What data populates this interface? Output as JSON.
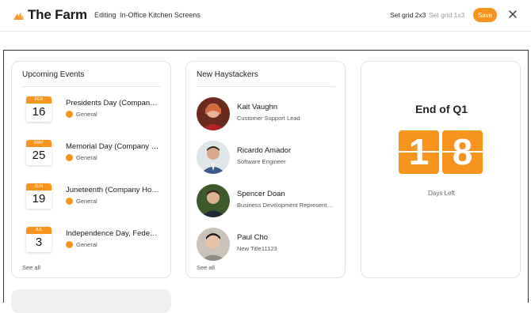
{
  "header": {
    "logo_text": "The Farm",
    "mode_label": "Editing",
    "screen_title": "In-Office Kitchen Screens",
    "grid_option_active": "Set grid 2x3",
    "grid_option_inactive": "Set grid 1x3",
    "save_label": "Save",
    "accent_color": "#f7941d"
  },
  "events_card": {
    "title": "Upcoming Events",
    "see_all": "See all",
    "items": [
      {
        "month": "FEB",
        "day": "16",
        "name": "Presidents Day (Company Holiday)",
        "category": "General"
      },
      {
        "month": "MAY",
        "day": "25",
        "name": "Memorial Day (Company Holiday)",
        "category": "General"
      },
      {
        "month": "JUN",
        "day": "19",
        "name": "Juneteenth (Company Holiday)",
        "category": "General"
      },
      {
        "month": "JUL",
        "day": "3",
        "name": "Independence Day, Federal Holiday",
        "category": "General"
      }
    ]
  },
  "haystackers_card": {
    "title": "New Haystackers",
    "see_all": "See all",
    "people": [
      {
        "name": "Kait Vaughn",
        "role": "Customer Support Lead"
      },
      {
        "name": "Ricardo Amador",
        "role": "Software Engineer"
      },
      {
        "name": "Spencer Doan",
        "role": "Business Development Representative"
      },
      {
        "name": "Paul Cho",
        "role": "New Title11123"
      }
    ]
  },
  "countdown_card": {
    "title": "End of Q1",
    "digit_1": "1",
    "digit_2": "8",
    "subtitle": "Days Left"
  }
}
